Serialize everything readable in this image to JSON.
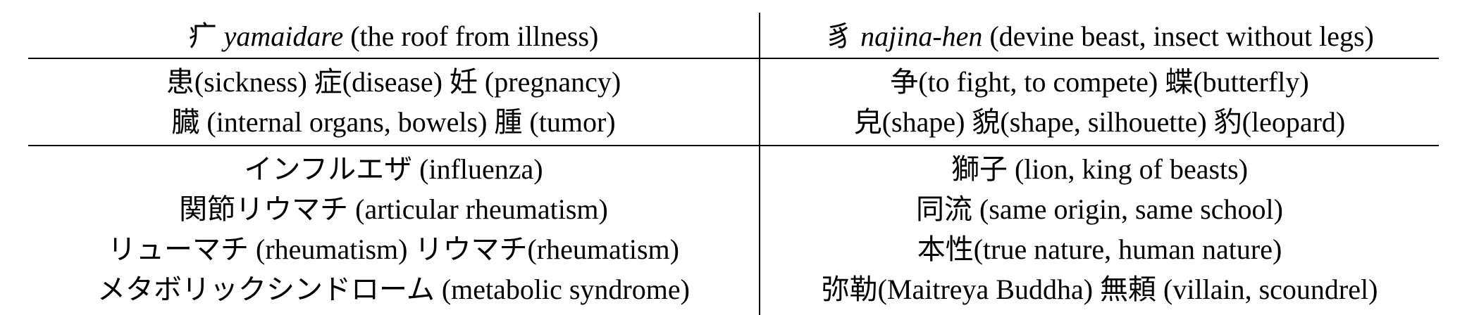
{
  "table": {
    "headers": [
      {
        "kanji": "疒",
        "romaji": "yamaidare",
        "gloss": "(the roof from illness)"
      },
      {
        "kanji": "豸",
        "romaji": "najina-hen",
        "gloss": "(devine beast, insect without legs)"
      }
    ],
    "section1": [
      [
        "患(sickness) 症(disease) 妊 (pregnancy)",
        "争(to fight, to compete) 蝶(butterfly)"
      ],
      [
        "臓 (internal organs, bowels) 腫 (tumor)",
        "皃(shape) 貌(shape, silhouette) 豹(leopard)"
      ]
    ],
    "section2": [
      [
        "インフルエザ (influenza)",
        "獅子 (lion, king of beasts)"
      ],
      [
        "関節リウマチ (articular rheumatism)",
        "同流 (same origin, same school)"
      ],
      [
        "リューマチ (rheumatism) リウマチ(rheumatism)",
        "本性(true nature, human nature)"
      ],
      [
        "メタボリックシンドローム (metabolic syndrome)",
        "弥勒(Maitreya Buddha) 無頼 (villain, scoundrel)"
      ]
    ]
  }
}
